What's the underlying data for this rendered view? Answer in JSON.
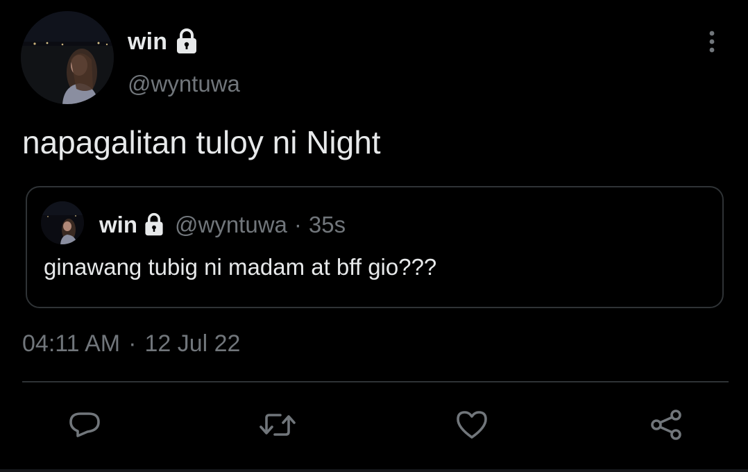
{
  "author": {
    "display_name": "win",
    "handle": "@wyntuwa",
    "protected_icon": "lock-icon"
  },
  "tweet": {
    "text": "napagalitan tuloy ni Night"
  },
  "quoted_tweet": {
    "display_name": "win",
    "handle": "@wyntuwa",
    "separator": "·",
    "time": "35s",
    "text": "ginawang tubig ni madam at bff gio???"
  },
  "meta": {
    "time": "04:11 AM",
    "separator": "·",
    "date": "12 Jul 22"
  },
  "actions": {
    "reply_icon": "comment-icon",
    "retweet_icon": "retweet-icon",
    "like_icon": "heart-icon",
    "share_icon": "share-icon",
    "more_icon": "more-vertical-icon"
  },
  "colors": {
    "background": "#000000",
    "primary_text": "#e7e9ea",
    "secondary_text": "#71767b",
    "border": "#2f3336"
  }
}
